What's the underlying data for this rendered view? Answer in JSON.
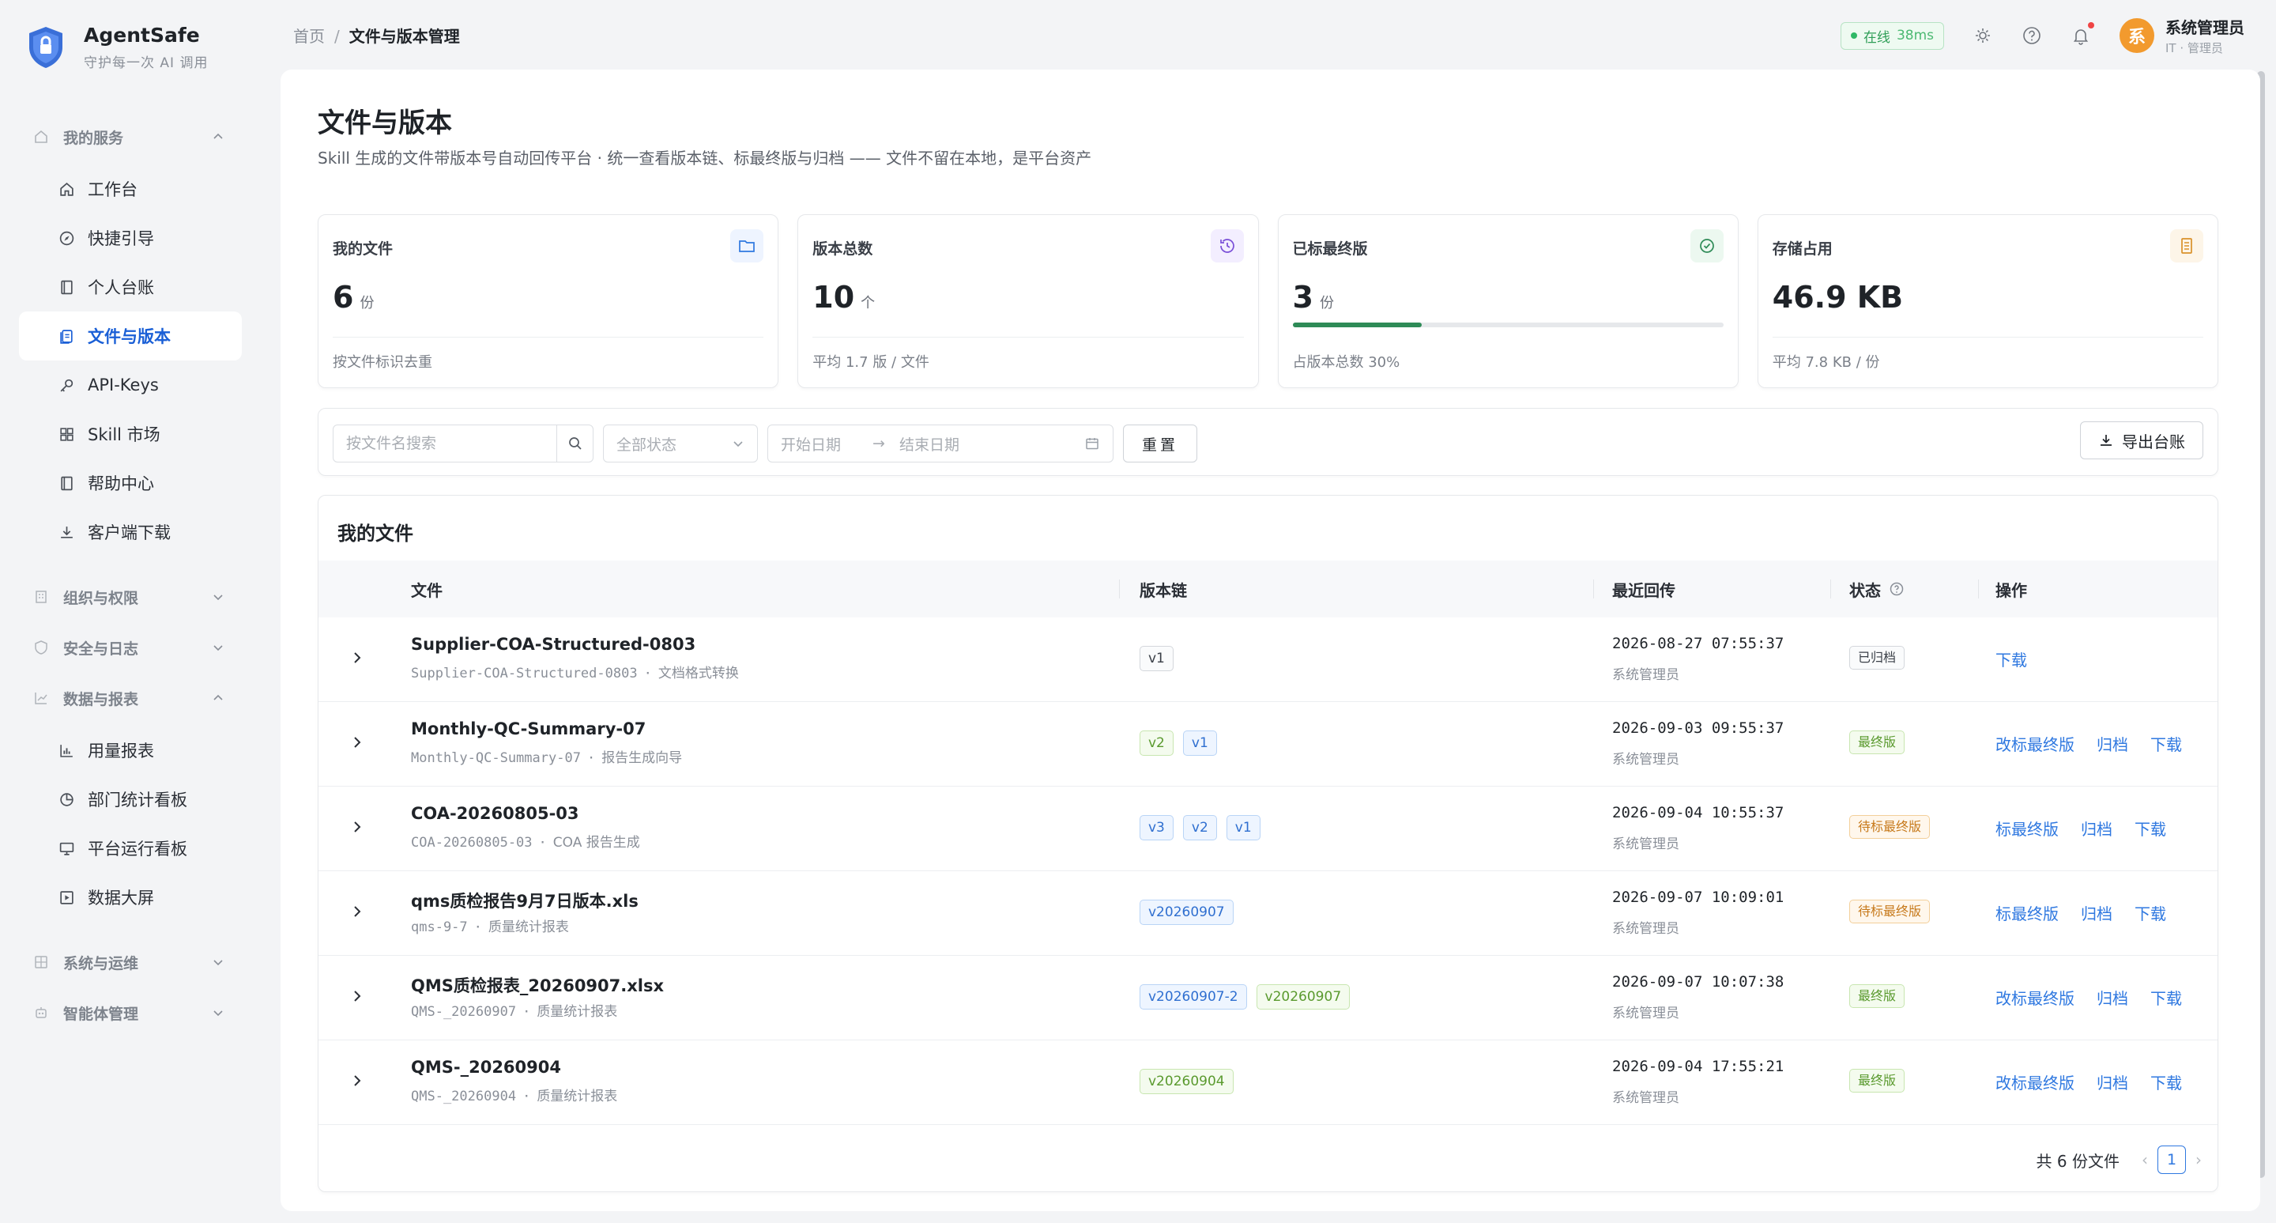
{
  "brand": {
    "name": "AgentSafe",
    "tagline": "守护每一次 AI 调用"
  },
  "sidebar": {
    "groups": [
      {
        "label": "我的服务",
        "expanded": true,
        "items": [
          {
            "label": "工作台",
            "icon": "home-icon"
          },
          {
            "label": "快捷引导",
            "icon": "compass-icon"
          },
          {
            "label": "个人台账",
            "icon": "book-icon"
          },
          {
            "label": "文件与版本",
            "icon": "files-icon",
            "active": true
          },
          {
            "label": "API-Keys",
            "icon": "key-icon"
          },
          {
            "label": "Skill 市场",
            "icon": "grid-icon"
          },
          {
            "label": "帮助中心",
            "icon": "help-book-icon"
          },
          {
            "label": "客户端下载",
            "icon": "download-icon"
          }
        ]
      },
      {
        "label": "组织与权限",
        "expanded": false
      },
      {
        "label": "安全与日志",
        "expanded": false
      },
      {
        "label": "数据与报表",
        "expanded": true,
        "items": [
          {
            "label": "用量报表",
            "icon": "bar-chart-icon"
          },
          {
            "label": "部门统计看板",
            "icon": "pie-chart-icon"
          },
          {
            "label": "平台运行看板",
            "icon": "monitor-icon"
          },
          {
            "label": "数据大屏",
            "icon": "screen-icon"
          }
        ]
      },
      {
        "label": "系统与运维",
        "expanded": false
      },
      {
        "label": "智能体管理",
        "expanded": false
      }
    ]
  },
  "breadcrumb": {
    "home": "首页",
    "sep": "/",
    "current": "文件与版本管理"
  },
  "topbar": {
    "online_label": "在线",
    "latency": "38ms",
    "user_avatar": "系",
    "user_name": "系统管理员",
    "user_role": "IT · 管理员"
  },
  "page": {
    "title": "文件与版本",
    "description": "Skill 生成的文件带版本号自动回传平台 · 统一查看版本链、标最终版与归档 —— 文件不留在本地，是平台资产"
  },
  "stats": [
    {
      "label": "我的文件",
      "value": "6",
      "unit": "份",
      "foot": "按文件标识去重",
      "icon": "folder-icon",
      "color": "#2f78e0"
    },
    {
      "label": "版本总数",
      "value": "10",
      "unit": "个",
      "foot": "平均 1.7 版 / 文件",
      "icon": "history-icon",
      "color": "#7a4fd8"
    },
    {
      "label": "已标最终版",
      "value": "3",
      "unit": "份",
      "foot": "占版本总数 30%",
      "icon": "check-circle-icon",
      "color": "#2e8b57",
      "progress": 0.3
    },
    {
      "label": "存储占用",
      "value": "46.9 KB",
      "unit": "",
      "foot": "平均 7.8 KB / 份",
      "icon": "storage-icon",
      "color": "#d9912a"
    }
  ],
  "filters": {
    "search_placeholder": "按文件名搜索",
    "status_placeholder": "全部状态",
    "start_placeholder": "开始日期",
    "end_placeholder": "结束日期",
    "reset_label": "重置",
    "export_label": "导出台账"
  },
  "table": {
    "title": "我的文件",
    "columns": {
      "file": "文件",
      "versions": "版本链",
      "upload": "最近回传",
      "status": "状态",
      "ops": "操作"
    },
    "rows": [
      {
        "name": "Supplier-COA-Structured-0803",
        "id": "Supplier-COA-Structured-0803",
        "tool": "文档格式转换",
        "versions": [
          {
            "v": "v1",
            "style": "gray"
          }
        ],
        "time": "2026-08-27 07:55:37",
        "user": "系统管理员",
        "status": "已归档",
        "status_type": "archived",
        "ops": [
          "下载"
        ]
      },
      {
        "name": "Monthly-QC-Summary-07",
        "id": "Monthly-QC-Summary-07",
        "tool": "报告生成向导",
        "versions": [
          {
            "v": "v2",
            "style": "green"
          },
          {
            "v": "v1",
            "style": "blue"
          }
        ],
        "time": "2026-09-03 09:55:37",
        "user": "系统管理员",
        "status": "最终版",
        "status_type": "final",
        "ops": [
          "改标最终版",
          "归档",
          "下载"
        ]
      },
      {
        "name": "COA-20260805-03",
        "id": "COA-20260805-03",
        "tool": "COA 报告生成",
        "versions": [
          {
            "v": "v3",
            "style": "blue"
          },
          {
            "v": "v2",
            "style": "blue"
          },
          {
            "v": "v1",
            "style": "blue"
          }
        ],
        "time": "2026-09-04 10:55:37",
        "user": "系统管理员",
        "status": "待标最终版",
        "status_type": "pending",
        "ops": [
          "标最终版",
          "归档",
          "下载"
        ]
      },
      {
        "name": "qms质检报告9月7日版本.xls",
        "id": "qms-9-7",
        "tool": "质量统计报表",
        "versions": [
          {
            "v": "v20260907",
            "style": "blue"
          }
        ],
        "time": "2026-09-07 10:09:01",
        "user": "系统管理员",
        "status": "待标最终版",
        "status_type": "pending",
        "ops": [
          "标最终版",
          "归档",
          "下载"
        ]
      },
      {
        "name": "QMS质检报表_20260907.xlsx",
        "id": "QMS-_20260907",
        "tool": "质量统计报表",
        "versions": [
          {
            "v": "v20260907-2",
            "style": "blue"
          },
          {
            "v": "v20260907",
            "style": "green"
          }
        ],
        "time": "2026-09-07 10:07:38",
        "user": "系统管理员",
        "status": "最终版",
        "status_type": "final",
        "ops": [
          "改标最终版",
          "归档",
          "下载"
        ]
      },
      {
        "name": "QMS-_20260904",
        "id": "QMS-_20260904",
        "tool": "质量统计报表",
        "versions": [
          {
            "v": "v20260904",
            "style": "green"
          }
        ],
        "time": "2026-09-04 17:55:21",
        "user": "系统管理员",
        "status": "最终版",
        "status_type": "final",
        "ops": [
          "改标最终版",
          "归档",
          "下载"
        ]
      }
    ]
  },
  "pager": {
    "total_label": "共 6 份文件",
    "current_page": "1"
  }
}
